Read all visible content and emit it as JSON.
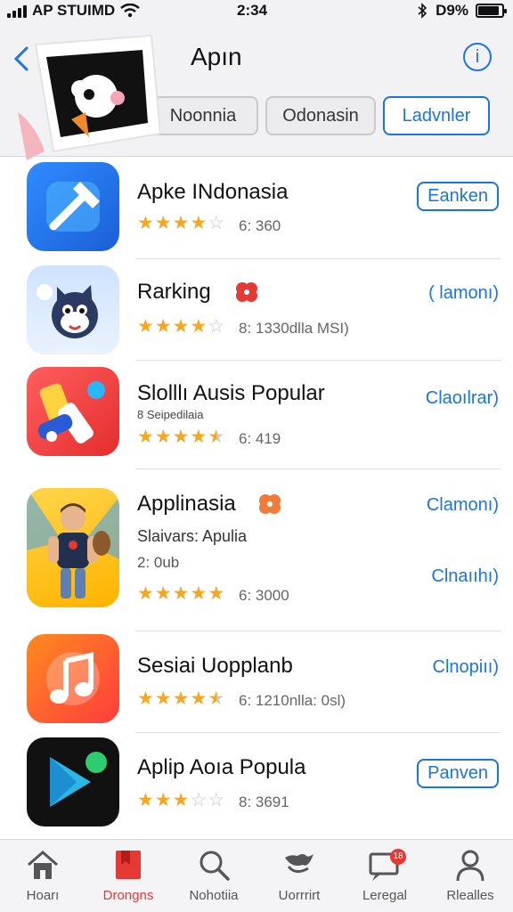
{
  "status_bar": {
    "carrier": "AP STUIMD",
    "time": "2:34",
    "battery": "D9%",
    "battery_level": 0.9
  },
  "header": {
    "back_icon": "chevron-left-icon",
    "title": "Apın",
    "info_icon": "info-icon",
    "segments": [
      {
        "label": "Noonnia",
        "active": false
      },
      {
        "label": "Odonasin",
        "active": false
      },
      {
        "label": "Ladvnler",
        "active": true
      }
    ]
  },
  "apps": [
    {
      "name": "Apke INdonasia",
      "sub": "",
      "stars": 4,
      "rating": "6: 360",
      "action": "Eanken",
      "action_style": "boxed"
    },
    {
      "name": "Rarking",
      "sub": "",
      "stars": 4,
      "rating": "8: 1330dlla MSI)",
      "action": "( lamonı)",
      "action_style": "link"
    },
    {
      "name": "Slolllı Ausis Popular",
      "sub": "8 Seipedilaia",
      "stars": 4.5,
      "rating": "6: 419",
      "action": "Claoılrar)",
      "action_style": "link"
    },
    {
      "name": "Applinasia",
      "sub": "Slaivars: Apulia",
      "sub2": "2: 0ub",
      "stars": 5,
      "rating": "6: 3000",
      "action": "Clamonı)",
      "action2": "Clnaııhı)",
      "action_style": "link"
    },
    {
      "name": "Sesiai Uopplanb",
      "sub": "",
      "stars": 4.5,
      "rating": "6: 1210nlla: 0sl)",
      "action": "Clnopiıı)",
      "action_style": "link"
    },
    {
      "name": "Aplip Aoıa Popula",
      "sub": "",
      "stars": 3,
      "rating": "8: 3691",
      "action": "Panven",
      "action_style": "boxed"
    }
  ],
  "tabs": [
    {
      "label": "Hoarı",
      "icon": "home-icon",
      "active": false
    },
    {
      "label": "Drongns",
      "icon": "bookmark-icon",
      "active": true
    },
    {
      "label": "Nohotiia",
      "icon": "search-icon",
      "active": false
    },
    {
      "label": "Uorrrirt",
      "icon": "bird-icon",
      "active": false
    },
    {
      "label": "Leregal",
      "icon": "message-icon",
      "active": false,
      "badge": "18"
    },
    {
      "label": "Rlealles",
      "icon": "person-icon",
      "active": false
    }
  ],
  "colors": {
    "accent": "#1a73e8",
    "star": "#f5a623",
    "active_tab": "#e53935"
  }
}
